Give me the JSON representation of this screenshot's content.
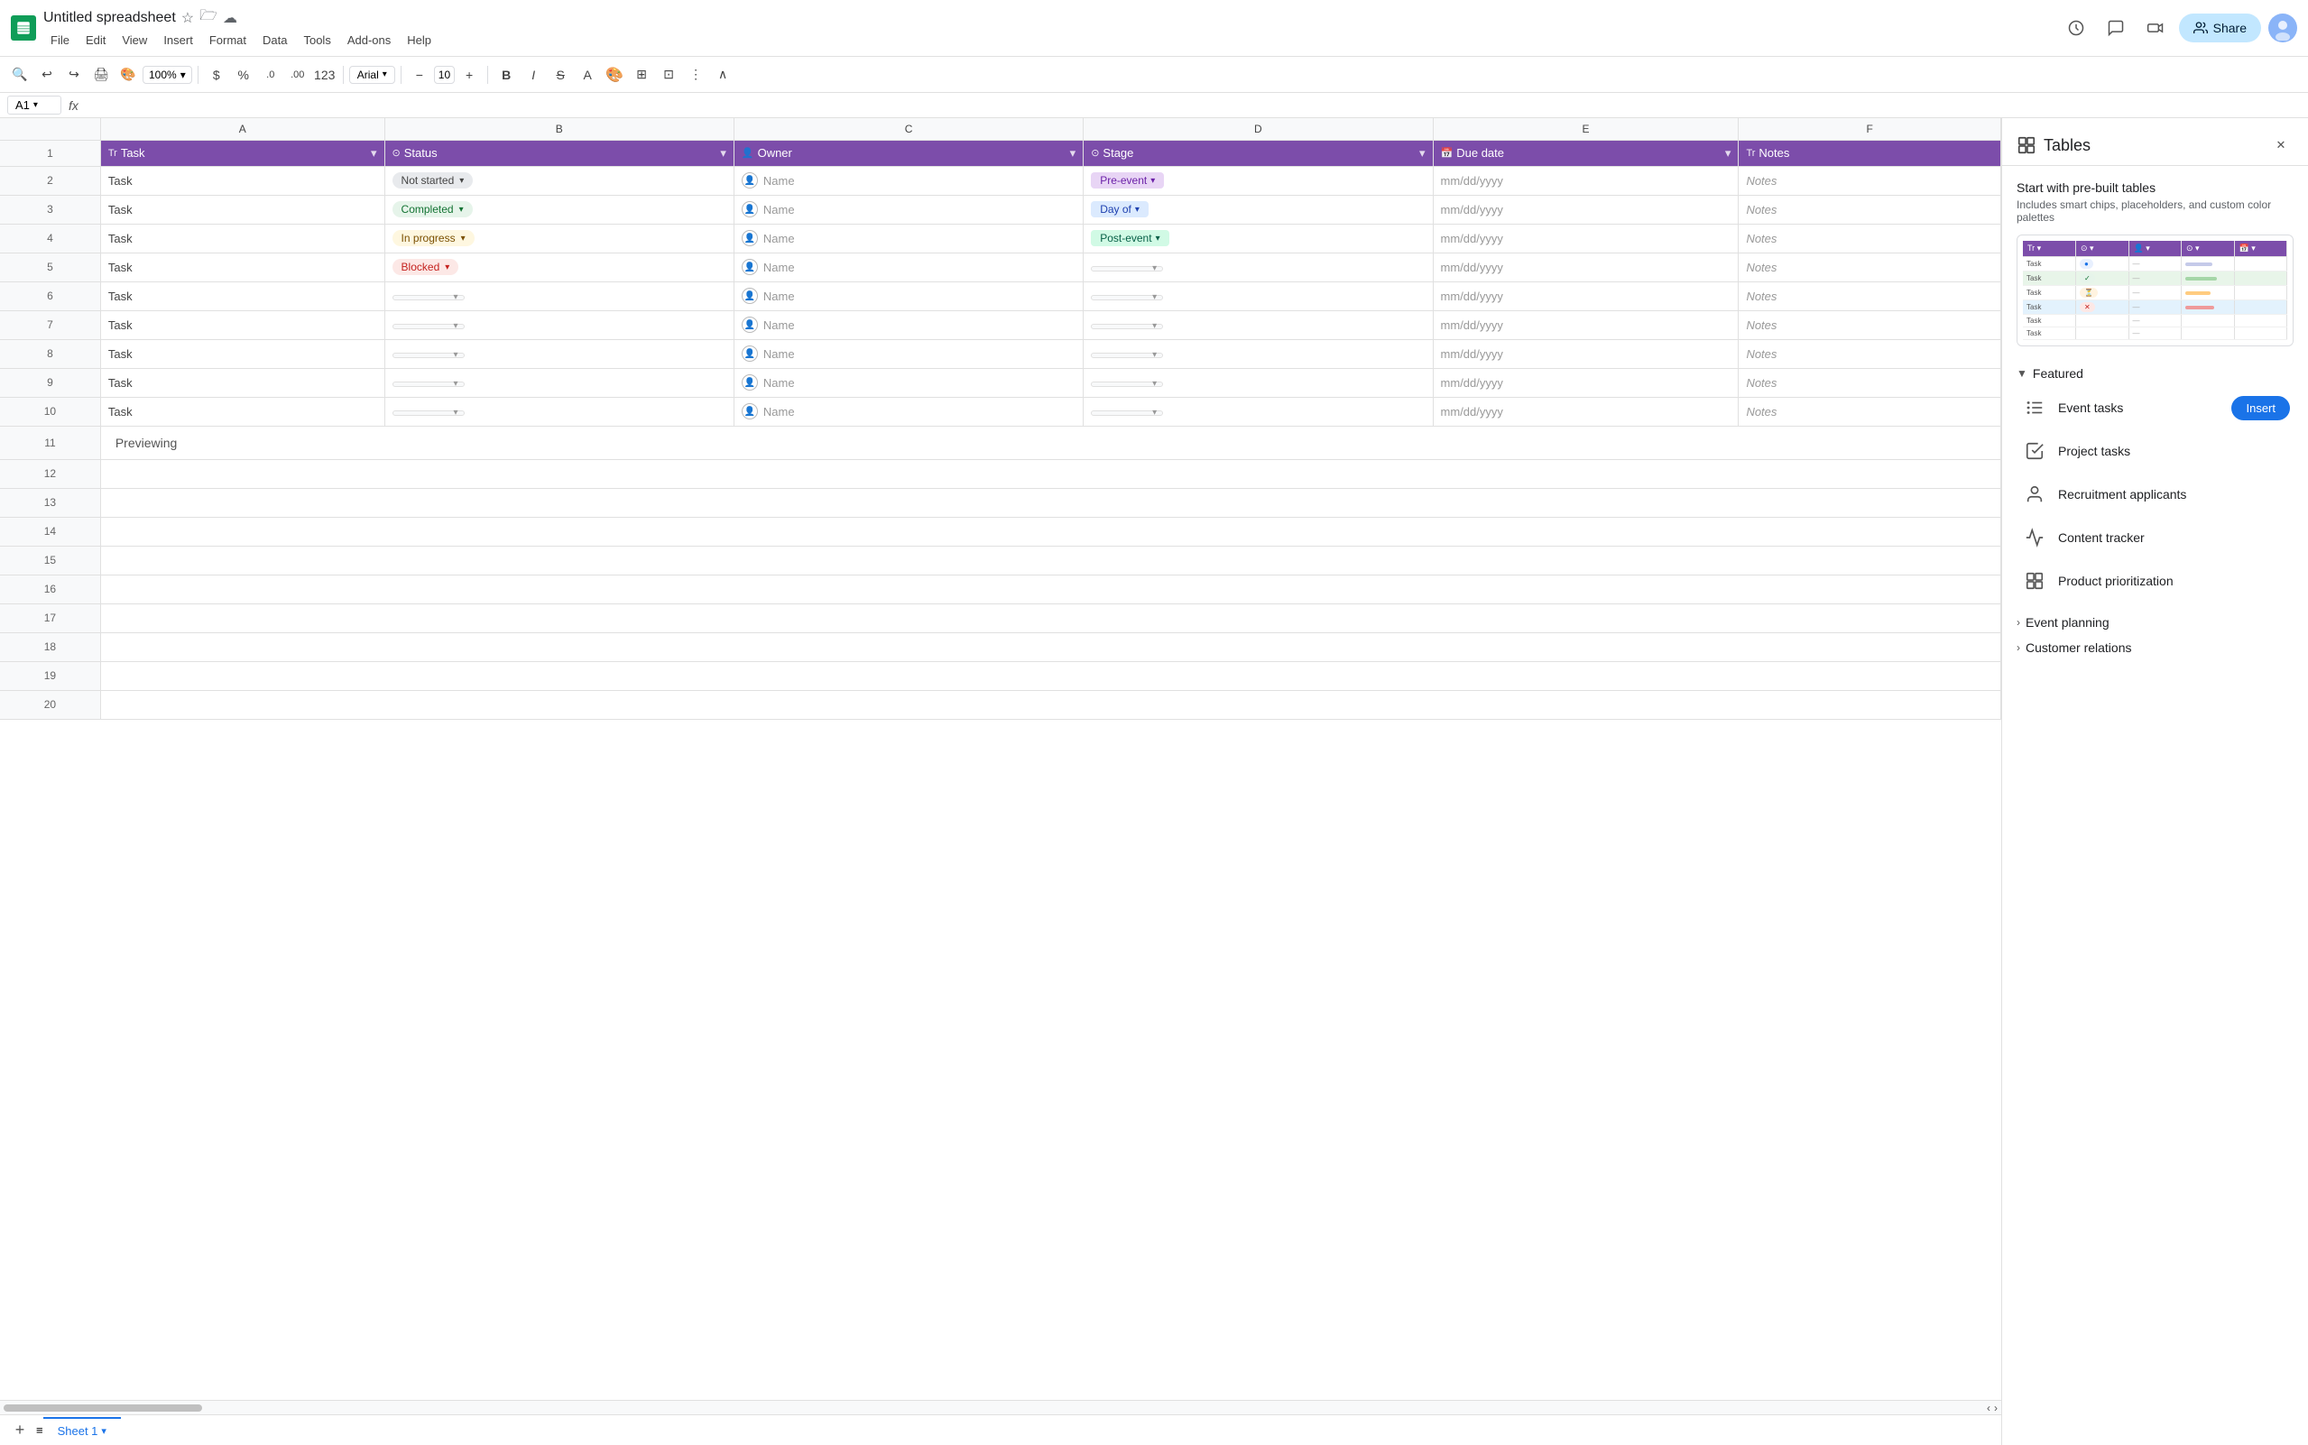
{
  "app": {
    "title": "Untitled spreadsheet",
    "icon_color": "#0f9d58"
  },
  "menu": {
    "items": [
      "File",
      "Edit",
      "View",
      "Insert",
      "Format",
      "Data",
      "Tools",
      "Add-ons",
      "Help"
    ]
  },
  "toolbar": {
    "zoom": "100%",
    "font_name": "Arial",
    "font_size": "10",
    "bold": "B",
    "italic": "I",
    "strikethrough": "S̶",
    "more": "⋮"
  },
  "formula_bar": {
    "cell_ref": "A1",
    "formula_icon": "fx"
  },
  "spreadsheet": {
    "col_headers": [
      "A",
      "B",
      "C",
      "D",
      "E",
      "F"
    ],
    "row_headers": [
      "1",
      "2",
      "3",
      "4",
      "5",
      "6",
      "7",
      "8",
      "9",
      "10",
      "11",
      "12",
      "13",
      "14",
      "15",
      "16",
      "17",
      "18",
      "19",
      "20"
    ],
    "header_row": {
      "task": "Task",
      "status": "Status",
      "owner": "Owner",
      "stage": "Stage",
      "due_date": "Due date",
      "notes": "Notes"
    },
    "rows": [
      {
        "row": 2,
        "task": "Task",
        "status": "not_started",
        "status_label": "Not started",
        "owner": "Name",
        "stage": "pre_event",
        "stage_label": "Pre-event",
        "due_date": "mm/dd/yyyy",
        "notes": "Notes"
      },
      {
        "row": 3,
        "task": "Task",
        "status": "completed",
        "status_label": "Completed",
        "owner": "Name",
        "stage": "day_of",
        "stage_label": "Day of",
        "due_date": "mm/dd/yyyy",
        "notes": "Notes"
      },
      {
        "row": 4,
        "task": "Task",
        "status": "in_progress",
        "status_label": "In progress",
        "owner": "Name",
        "stage": "post_event",
        "stage_label": "Post-event",
        "due_date": "mm/dd/yyyy",
        "notes": "Notes"
      },
      {
        "row": 5,
        "task": "Task",
        "status": "blocked",
        "status_label": "Blocked",
        "owner": "Name",
        "stage": "empty",
        "stage_label": "",
        "due_date": "mm/dd/yyyy",
        "notes": "Notes"
      },
      {
        "row": 6,
        "task": "Task",
        "status": "empty",
        "owner": "Name",
        "stage": "empty",
        "due_date": "mm/dd/yyyy",
        "notes": "Notes"
      },
      {
        "row": 7,
        "task": "Task",
        "status": "empty",
        "owner": "Name",
        "stage": "empty",
        "due_date": "mm/dd/yyyy",
        "notes": "Notes"
      },
      {
        "row": 8,
        "task": "Task",
        "status": "empty",
        "owner": "Name",
        "stage": "empty",
        "due_date": "mm/dd/yyyy",
        "notes": "Notes"
      },
      {
        "row": 9,
        "task": "Task",
        "status": "empty",
        "owner": "Name",
        "stage": "empty",
        "due_date": "mm/dd/yyyy",
        "notes": "Notes"
      },
      {
        "row": 10,
        "task": "Task",
        "status": "empty",
        "owner": "Name",
        "stage": "empty",
        "due_date": "mm/dd/yyyy",
        "notes": "Notes"
      }
    ],
    "preview_text": "Previewing"
  },
  "right_panel": {
    "title": "Tables",
    "title_icon": "tables-icon",
    "subtitle": "Start with pre-built tables",
    "description": "Includes smart chips, placeholders, and custom color palettes",
    "sections": {
      "featured": {
        "label": "Featured",
        "items": [
          {
            "id": "event-tasks",
            "name": "Event tasks",
            "icon": "checklist-icon",
            "has_insert": true,
            "insert_label": "Insert"
          },
          {
            "id": "project-tasks",
            "name": "Project tasks",
            "icon": "checklist2-icon",
            "has_insert": false
          },
          {
            "id": "recruitment-applicants",
            "name": "Recruitment applicants",
            "icon": "person-icon",
            "has_insert": false
          },
          {
            "id": "content-tracker",
            "name": "Content tracker",
            "icon": "trend-icon",
            "has_insert": false
          },
          {
            "id": "product-prioritization",
            "name": "Product prioritization",
            "icon": "table-icon",
            "has_insert": false
          }
        ]
      },
      "event_planning": {
        "label": "Event planning",
        "collapsed": false
      },
      "customer_relations": {
        "label": "Customer relations",
        "collapsed": false
      }
    }
  },
  "bottom": {
    "sheet_name": "Sheet 1"
  }
}
